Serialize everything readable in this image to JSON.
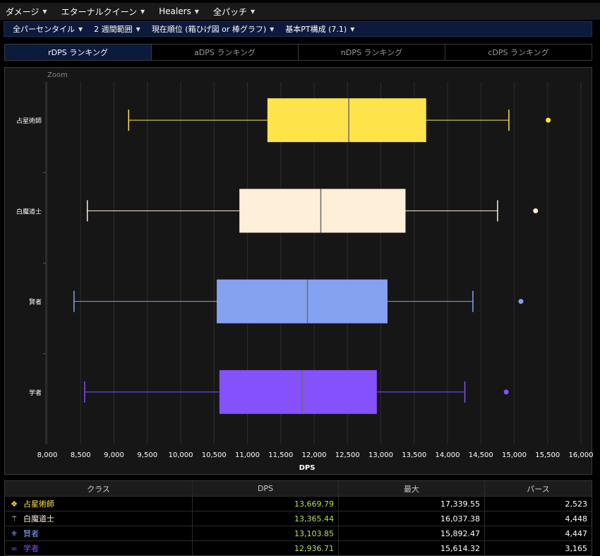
{
  "menu": {
    "items": [
      {
        "label": "ダメージ"
      },
      {
        "label": "エターナルクイーン"
      },
      {
        "label": "Healers"
      },
      {
        "label": "全パッチ"
      }
    ]
  },
  "filters": {
    "items": [
      {
        "label": "全パーセンタイル"
      },
      {
        "label": "2 週間範囲"
      },
      {
        "label": "現在順位 (箱ひげ図 or 棒グラフ)"
      },
      {
        "label": "基本PT構成 (7.1)"
      }
    ]
  },
  "tabs": [
    {
      "label": "rDPS ランキング",
      "active": true
    },
    {
      "label": "aDPS ランキング",
      "active": false
    },
    {
      "label": "nDPS ランキング",
      "active": false
    },
    {
      "label": "cDPS ランキング",
      "active": false
    }
  ],
  "chart_zoom_label": "Zoom",
  "chart_data": {
    "type": "boxplot",
    "orientation": "horizontal",
    "xlabel": "DPS",
    "ylabel": "",
    "xlim": [
      8000,
      16000
    ],
    "xticks": [
      8000,
      8500,
      9000,
      9500,
      10000,
      10500,
      11000,
      11500,
      12000,
      12500,
      13000,
      13500,
      14000,
      14500,
      15000,
      15500,
      16000
    ],
    "xtick_labels": [
      "8,000",
      "8,500",
      "9,000",
      "9,500",
      "10,000",
      "10,500",
      "11,000",
      "11,500",
      "12,000",
      "12,500",
      "13,000",
      "13,500",
      "14,000",
      "14,500",
      "15,000",
      "15,500",
      "16,000"
    ],
    "grid": true,
    "series": [
      {
        "name": "占星術師",
        "color": "#ffe34a",
        "min": 9220,
        "q1": 11300,
        "median": 12520,
        "q3": 13680,
        "max": 14920,
        "outliers": [
          15510
        ]
      },
      {
        "name": "白魔道士",
        "color": "#fdefd9",
        "min": 8600,
        "q1": 10880,
        "median": 12100,
        "q3": 13370,
        "max": 14750,
        "outliers": [
          15320
        ]
      },
      {
        "name": "賢者",
        "color": "#84a2ef",
        "min": 8400,
        "q1": 10540,
        "median": 11900,
        "q3": 13100,
        "max": 14380,
        "outliers": [
          15100
        ]
      },
      {
        "name": "学者",
        "color": "#8451fa",
        "min": 8560,
        "q1": 10580,
        "median": 11820,
        "q3": 12940,
        "max": 14260,
        "outliers": [
          14880
        ]
      }
    ]
  },
  "table": {
    "headers": {
      "class": "クラス",
      "dps": "DPS",
      "max": "最大",
      "parses": "パース"
    },
    "rows": [
      {
        "icon": "astrologian-icon",
        "glyph": "❖",
        "name": "占星術師",
        "color": "#ffe34a",
        "dps": "13,669.79",
        "max": "17,339.55",
        "parses": "2,523"
      },
      {
        "icon": "whitemage-icon",
        "glyph": "⚚",
        "name": "白魔道士",
        "color": "#fdefd9",
        "dps": "13,365.44",
        "max": "16,037.38",
        "parses": "4,448"
      },
      {
        "icon": "sage-icon",
        "glyph": "⚜",
        "name": "賢者",
        "color": "#84a2ef",
        "dps": "13,103.85",
        "max": "15,892.47",
        "parses": "4,447"
      },
      {
        "icon": "scholar-icon",
        "glyph": "∞",
        "name": "学者",
        "color": "#8451fa",
        "dps": "12,936.71",
        "max": "15,614.32",
        "parses": "3,165"
      }
    ]
  }
}
